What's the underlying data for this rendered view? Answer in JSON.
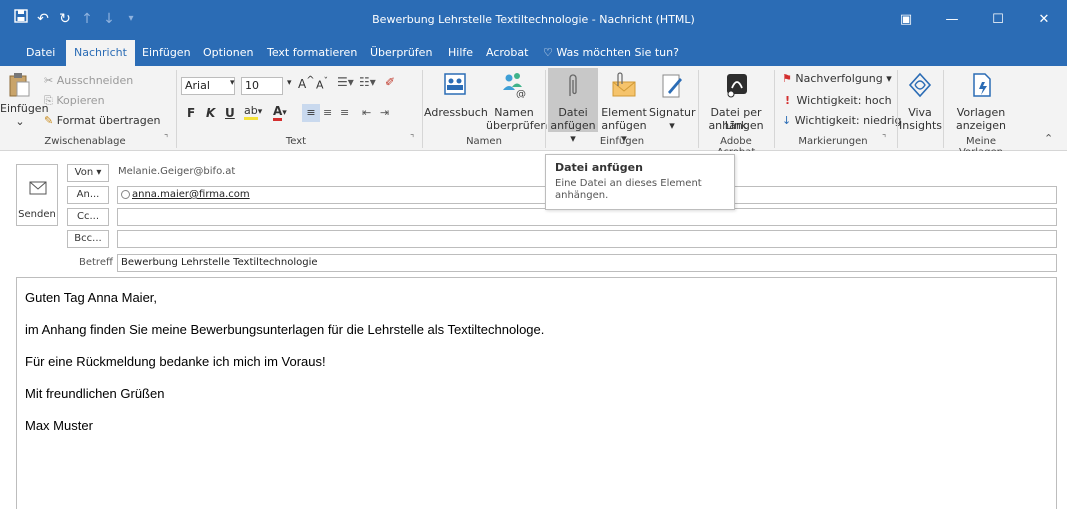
{
  "window": {
    "title": "Bewerbung Lehrstelle Textiltechnologie  -  Nachricht (HTML)",
    "accent": "#2b6cb5"
  },
  "qat": [
    "save-icon",
    "undo-icon",
    "redo-icon",
    "up-arrow-icon",
    "down-arrow-icon",
    "customize-icon"
  ],
  "tabs": [
    {
      "label": "Datei"
    },
    {
      "label": "Nachricht"
    },
    {
      "label": "Einfügen"
    },
    {
      "label": "Optionen"
    },
    {
      "label": "Text formatieren"
    },
    {
      "label": "Überprüfen"
    },
    {
      "label": "Hilfe"
    },
    {
      "label": "Acrobat"
    },
    {
      "label": "Was möchten Sie tun?"
    }
  ],
  "ribbon": {
    "clipboard": {
      "paste": "Einfügen",
      "cut": "Ausschneiden",
      "copy": "Kopieren",
      "format_painter": "Format übertragen",
      "group": "Zwischenablage"
    },
    "text": {
      "font": "Arial",
      "size": "10",
      "bold": "F",
      "italic": "K",
      "underline": "U",
      "grow": "A",
      "shrink": "A",
      "font_color_letter": "A",
      "group": "Text"
    },
    "names": {
      "address_book": "Adressbuch",
      "check_names_1": "Namen",
      "check_names_2": "überprüfen",
      "group": "Namen"
    },
    "include": {
      "attach_file_1": "Datei",
      "attach_file_2": "anfügen ▾",
      "attach_item_1": "Element",
      "attach_item_2": "anfügen ▾",
      "signature_1": "Signatur",
      "signature_2": "▾",
      "group": "Einfügen"
    },
    "acrobat": {
      "attach_link_1": "Datei per Link",
      "attach_link_2": "anhängen",
      "group": "Adobe Acrobat"
    },
    "tags": {
      "follow_up": "Nachverfolgung ▾",
      "high": "Wichtigkeit: hoch",
      "low": "Wichtigkeit: niedrig",
      "group": "Markierungen"
    },
    "viva": {
      "label_1": "Viva",
      "label_2": "Insights"
    },
    "templates": {
      "label_1": "Vorlagen",
      "label_2": "anzeigen",
      "group": "Meine Vorlagen"
    }
  },
  "tooltip": {
    "title": "Datei anfügen",
    "body_1": "Eine Datei an dieses Element",
    "body_2": "anhängen."
  },
  "compose": {
    "send": "Senden",
    "from_button": "Von ▾",
    "from_value": "Melanie.Geiger@bifo.at",
    "to_button": "An...",
    "to_value": "anna.maier@firma.com",
    "cc_button": "Cc...",
    "bcc_button": "Bcc...",
    "subject_label": "Betreff",
    "subject_value": "Bewerbung Lehrstelle Textiltechnologie"
  },
  "body": {
    "lines": [
      "Guten Tag Anna Maier,",
      "im Anhang finden Sie meine Bewerbungsunterlagen für die Lehrstelle als Textiltechnologe.",
      "Für eine Rückmeldung bedanke ich mich im Voraus!",
      "Mit freundlichen Grüßen",
      "Max Muster"
    ]
  }
}
